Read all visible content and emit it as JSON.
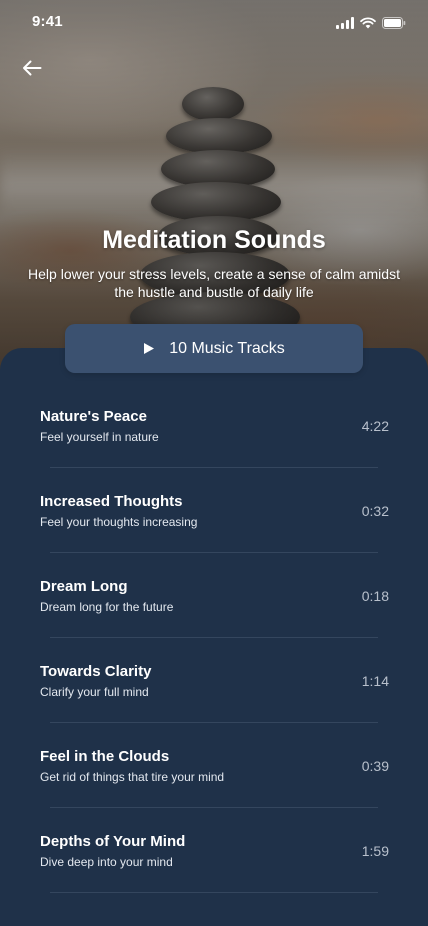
{
  "status_bar": {
    "time": "9:41"
  },
  "header": {
    "title": "Meditation Sounds",
    "subtitle": "Help lower your stress levels, create a sense of calm amidst the hustle and bustle of daily life"
  },
  "tracks_button": {
    "label": "10 Music Tracks"
  },
  "tracks": [
    {
      "title": "Nature's Peace",
      "description": "Feel yourself in nature",
      "duration": "4:22"
    },
    {
      "title": "Increased Thoughts",
      "description": "Feel your thoughts increasing",
      "duration": "0:32"
    },
    {
      "title": "Dream Long",
      "description": "Dream long for the future",
      "duration": "0:18"
    },
    {
      "title": "Towards Clarity",
      "description": "Clarify your full mind",
      "duration": "1:14"
    },
    {
      "title": "Feel in the Clouds",
      "description": "Get rid of things that tire your mind",
      "duration": "0:39"
    },
    {
      "title": "Depths of Your Mind",
      "description": "Dive deep into your mind",
      "duration": "1:59"
    }
  ],
  "icons": {
    "back": "arrow-left-icon",
    "play": "play-icon",
    "signal": "cellular-signal-icon",
    "wifi": "wifi-icon",
    "battery": "battery-icon"
  },
  "colors": {
    "panel_background": "#1f3149",
    "button_background": "#3b5170",
    "divider": "#34465e",
    "text_primary": "#ffffff",
    "text_duration": "#b8c0cc"
  }
}
